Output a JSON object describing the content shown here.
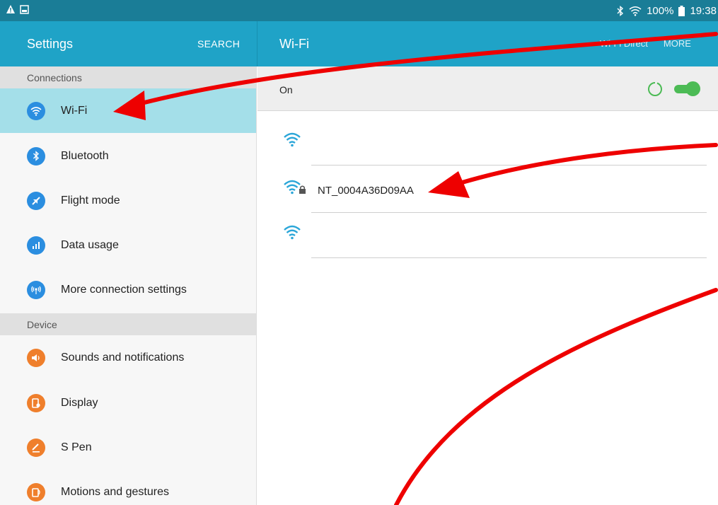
{
  "status_bar": {
    "battery": "100%",
    "time": "19:38",
    "icons": [
      "warning-icon",
      "gallery-icon",
      "bluetooth-icon",
      "wifi-icon",
      "battery-icon"
    ]
  },
  "app_bar": {
    "settings_title": "Settings",
    "search_label": "SEARCH",
    "page_title": "Wi-Fi",
    "wifi_direct_label": "Wi-Fi Direct",
    "more_label": "MORE"
  },
  "sidebar": {
    "sections": [
      {
        "header": "Connections",
        "items": [
          {
            "label": "Wi-Fi",
            "icon": "wifi-icon",
            "selected": true
          },
          {
            "label": "Bluetooth",
            "icon": "bluetooth-icon"
          },
          {
            "label": "Flight mode",
            "icon": "airplane-icon"
          },
          {
            "label": "Data usage",
            "icon": "data-usage-icon"
          },
          {
            "label": "More connection settings",
            "icon": "more-connection-icon"
          }
        ]
      },
      {
        "header": "Device",
        "items": [
          {
            "label": "Sounds and notifications",
            "icon": "sound-icon"
          },
          {
            "label": "Display",
            "icon": "display-icon"
          },
          {
            "label": "S Pen",
            "icon": "pen-icon"
          },
          {
            "label": "Motions and gestures",
            "icon": "motion-icon"
          }
        ]
      }
    ]
  },
  "wifi": {
    "state_label": "On",
    "toggle_on": true,
    "networks": [
      {
        "ssid": "",
        "secured": false
      },
      {
        "ssid": "NT_0004A36D09AA",
        "secured": true
      },
      {
        "ssid": "",
        "secured": false
      }
    ]
  },
  "colors": {
    "status_bar": "#1a7d97",
    "app_bar": "#1fa3c7",
    "selected_item": "#a4dfe9",
    "section_header": "#e0e0e0",
    "icon_blue": "#2b8ee0",
    "icon_orange": "#ef7f2c",
    "toggle_green": "#4cbb55",
    "annotation_arrow": "#ee0000"
  }
}
